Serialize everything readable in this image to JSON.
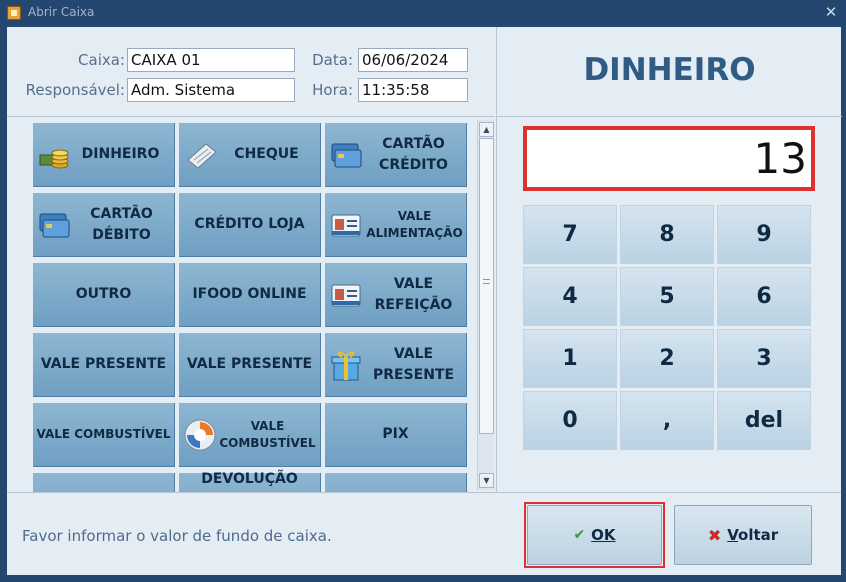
{
  "window": {
    "title": "Abrir Caixa"
  },
  "header": {
    "caixa_label": "Caixa:",
    "caixa_value": "CAIXA 01",
    "data_label": "Data:",
    "data_value": "06/06/2024",
    "responsavel_label": "Responsável:",
    "responsavel_value": "Adm. Sistema",
    "hora_label": "Hora:",
    "hora_value": "11:35:58"
  },
  "payment_methods": [
    {
      "label": "DINHEIRO",
      "icon": "coins-icon"
    },
    {
      "label": "CHEQUE",
      "icon": "cheque-icon"
    },
    {
      "label": "CARTÃO CRÉDITO",
      "icon": "credit-card-icon"
    },
    {
      "label": "CARTÃO DÉBITO",
      "icon": "credit-card-icon"
    },
    {
      "label": "CRÉDITO LOJA",
      "icon": ""
    },
    {
      "label": "VALE ALIMENTAÇÃO",
      "icon": "id-card-icon"
    },
    {
      "label": "OUTRO",
      "icon": ""
    },
    {
      "label": "IFOOD ONLINE",
      "icon": ""
    },
    {
      "label": "VALE REFEIÇÃO",
      "icon": "id-card-icon"
    },
    {
      "label": "VALE PRESENTE",
      "icon": ""
    },
    {
      "label": "VALE PRESENTE",
      "icon": ""
    },
    {
      "label": "VALE PRESENTE",
      "icon": "gift-icon"
    },
    {
      "label": "VALE COMBUSTÍVEL",
      "icon": ""
    },
    {
      "label": "VALE COMBUSTÍVEL",
      "icon": "fuel-badge-icon"
    },
    {
      "label": "PIX",
      "icon": ""
    }
  ],
  "partial_row": {
    "label": "DEVOLUÇÃO"
  },
  "selected_method": "DINHEIRO",
  "amount": "13",
  "keypad": [
    "7",
    "8",
    "9",
    "4",
    "5",
    "6",
    "1",
    "2",
    "3",
    "0",
    ",",
    "del"
  ],
  "footer": {
    "status": "Favor informar o valor de fundo de caixa.",
    "ok_label": "OK",
    "voltar_label": "Voltar"
  },
  "colors": {
    "accent": "#2f5b84",
    "button": "#7fabcb",
    "highlight": "#e03131",
    "titlebar": "#24476f"
  }
}
